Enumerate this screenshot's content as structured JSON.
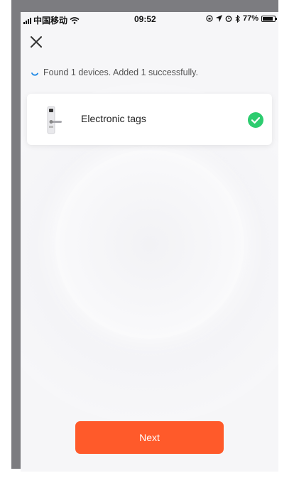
{
  "status_bar": {
    "carrier": "中国移动",
    "time": "09:52",
    "battery": "77%",
    "icons": [
      "signal-icon",
      "wifi-icon",
      "lock-rotation-icon",
      "location-icon",
      "alarm-icon",
      "bluetooth-icon",
      "battery-icon"
    ]
  },
  "header": {
    "close_icon": "close-icon"
  },
  "scan": {
    "status_text": "Found 1 devices. Added 1 successfully.",
    "spinner_icon": "spinner-icon"
  },
  "devices": [
    {
      "name": "Electronic tags",
      "icon": "door-lock-icon",
      "status_icon": "check-circle-icon",
      "status_color": "#2dcc6f"
    }
  ],
  "footer": {
    "next_label": "Next",
    "button_color": "#ff5a2a"
  }
}
